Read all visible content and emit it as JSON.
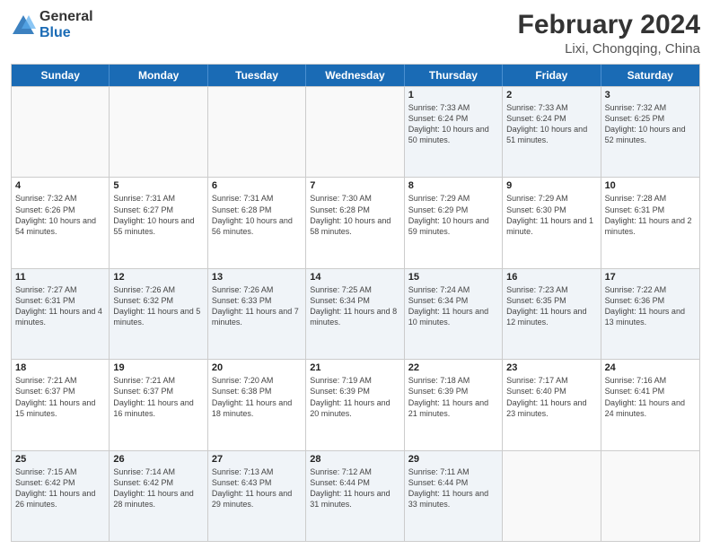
{
  "header": {
    "logo_general": "General",
    "logo_blue": "Blue",
    "title": "February 2024",
    "subtitle": "Lixi, Chongqing, China"
  },
  "days_of_week": [
    "Sunday",
    "Monday",
    "Tuesday",
    "Wednesday",
    "Thursday",
    "Friday",
    "Saturday"
  ],
  "rows": [
    [
      {
        "day": "",
        "info": ""
      },
      {
        "day": "",
        "info": ""
      },
      {
        "day": "",
        "info": ""
      },
      {
        "day": "",
        "info": ""
      },
      {
        "day": "1",
        "info": "Sunrise: 7:33 AM\nSunset: 6:24 PM\nDaylight: 10 hours and 50 minutes."
      },
      {
        "day": "2",
        "info": "Sunrise: 7:33 AM\nSunset: 6:24 PM\nDaylight: 10 hours and 51 minutes."
      },
      {
        "day": "3",
        "info": "Sunrise: 7:32 AM\nSunset: 6:25 PM\nDaylight: 10 hours and 52 minutes."
      }
    ],
    [
      {
        "day": "4",
        "info": "Sunrise: 7:32 AM\nSunset: 6:26 PM\nDaylight: 10 hours and 54 minutes."
      },
      {
        "day": "5",
        "info": "Sunrise: 7:31 AM\nSunset: 6:27 PM\nDaylight: 10 hours and 55 minutes."
      },
      {
        "day": "6",
        "info": "Sunrise: 7:31 AM\nSunset: 6:28 PM\nDaylight: 10 hours and 56 minutes."
      },
      {
        "day": "7",
        "info": "Sunrise: 7:30 AM\nSunset: 6:28 PM\nDaylight: 10 hours and 58 minutes."
      },
      {
        "day": "8",
        "info": "Sunrise: 7:29 AM\nSunset: 6:29 PM\nDaylight: 10 hours and 59 minutes."
      },
      {
        "day": "9",
        "info": "Sunrise: 7:29 AM\nSunset: 6:30 PM\nDaylight: 11 hours and 1 minute."
      },
      {
        "day": "10",
        "info": "Sunrise: 7:28 AM\nSunset: 6:31 PM\nDaylight: 11 hours and 2 minutes."
      }
    ],
    [
      {
        "day": "11",
        "info": "Sunrise: 7:27 AM\nSunset: 6:31 PM\nDaylight: 11 hours and 4 minutes."
      },
      {
        "day": "12",
        "info": "Sunrise: 7:26 AM\nSunset: 6:32 PM\nDaylight: 11 hours and 5 minutes."
      },
      {
        "day": "13",
        "info": "Sunrise: 7:26 AM\nSunset: 6:33 PM\nDaylight: 11 hours and 7 minutes."
      },
      {
        "day": "14",
        "info": "Sunrise: 7:25 AM\nSunset: 6:34 PM\nDaylight: 11 hours and 8 minutes."
      },
      {
        "day": "15",
        "info": "Sunrise: 7:24 AM\nSunset: 6:34 PM\nDaylight: 11 hours and 10 minutes."
      },
      {
        "day": "16",
        "info": "Sunrise: 7:23 AM\nSunset: 6:35 PM\nDaylight: 11 hours and 12 minutes."
      },
      {
        "day": "17",
        "info": "Sunrise: 7:22 AM\nSunset: 6:36 PM\nDaylight: 11 hours and 13 minutes."
      }
    ],
    [
      {
        "day": "18",
        "info": "Sunrise: 7:21 AM\nSunset: 6:37 PM\nDaylight: 11 hours and 15 minutes."
      },
      {
        "day": "19",
        "info": "Sunrise: 7:21 AM\nSunset: 6:37 PM\nDaylight: 11 hours and 16 minutes."
      },
      {
        "day": "20",
        "info": "Sunrise: 7:20 AM\nSunset: 6:38 PM\nDaylight: 11 hours and 18 minutes."
      },
      {
        "day": "21",
        "info": "Sunrise: 7:19 AM\nSunset: 6:39 PM\nDaylight: 11 hours and 20 minutes."
      },
      {
        "day": "22",
        "info": "Sunrise: 7:18 AM\nSunset: 6:39 PM\nDaylight: 11 hours and 21 minutes."
      },
      {
        "day": "23",
        "info": "Sunrise: 7:17 AM\nSunset: 6:40 PM\nDaylight: 11 hours and 23 minutes."
      },
      {
        "day": "24",
        "info": "Sunrise: 7:16 AM\nSunset: 6:41 PM\nDaylight: 11 hours and 24 minutes."
      }
    ],
    [
      {
        "day": "25",
        "info": "Sunrise: 7:15 AM\nSunset: 6:42 PM\nDaylight: 11 hours and 26 minutes."
      },
      {
        "day": "26",
        "info": "Sunrise: 7:14 AM\nSunset: 6:42 PM\nDaylight: 11 hours and 28 minutes."
      },
      {
        "day": "27",
        "info": "Sunrise: 7:13 AM\nSunset: 6:43 PM\nDaylight: 11 hours and 29 minutes."
      },
      {
        "day": "28",
        "info": "Sunrise: 7:12 AM\nSunset: 6:44 PM\nDaylight: 11 hours and 31 minutes."
      },
      {
        "day": "29",
        "info": "Sunrise: 7:11 AM\nSunset: 6:44 PM\nDaylight: 11 hours and 33 minutes."
      },
      {
        "day": "",
        "info": ""
      },
      {
        "day": "",
        "info": ""
      }
    ]
  ],
  "alt_rows": [
    0,
    2,
    4
  ]
}
